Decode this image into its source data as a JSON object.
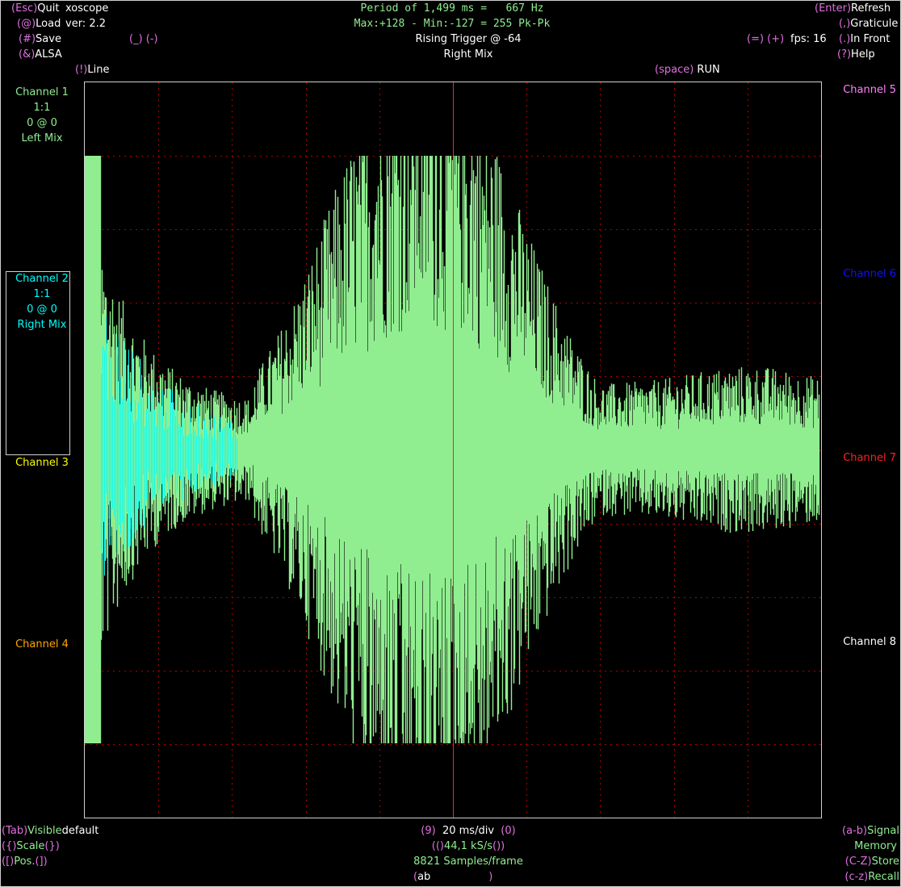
{
  "app": {
    "title": "xoscope",
    "version": "ver: 2.2"
  },
  "menu": {
    "quit": {
      "key": "(Esc)",
      "label": "Quit"
    },
    "load": {
      "key": "(@)",
      "label": "Load"
    },
    "save": {
      "key": "(#)",
      "label": "Save"
    },
    "alsa": {
      "key": "(&)",
      "label": "ALSA"
    },
    "line": {
      "key": "(!)",
      "label": "Line"
    },
    "refresh": {
      "key": "(Enter)",
      "label": "Refresh"
    },
    "graticule": {
      "key": "(,)",
      "label": "Graticule"
    },
    "in_front": {
      "key": "(.)",
      "label": "In Front"
    },
    "help": {
      "key": "(?)",
      "label": "Help"
    },
    "run": {
      "key": "(space)",
      "label": "RUN"
    },
    "minus_key": "(_) (-)",
    "plus_key": "(=) (+)",
    "fps": "fps: 16"
  },
  "measure": {
    "period": "Period of 1,499 ms =   667 Hz",
    "maxmin": "Max:+128 - Min:-127 = 255 Pk-Pk",
    "trigger": "Rising Trigger @ -64",
    "trigger_source": "Right Mix"
  },
  "channels": {
    "ch1": {
      "name": "Channel 1",
      "scale": "1:1",
      "pos": "0 @ 0",
      "source": "Left Mix",
      "color": "#90ee90"
    },
    "ch2": {
      "name": "Channel 2",
      "scale": "1:1",
      "pos": "0 @ 0",
      "source": "Right Mix",
      "color": "#00ffff"
    },
    "ch3": {
      "name": "Channel 3",
      "color": "#ffff00"
    },
    "ch4": {
      "name": "Channel 4",
      "color": "#ffa500"
    },
    "ch5": {
      "name": "Channel 5",
      "color": "#ff80ff"
    },
    "ch6": {
      "name": "Channel 6",
      "color": "#1010ff"
    },
    "ch7": {
      "name": "Channel 7",
      "color": "#ff2020"
    },
    "ch8": {
      "name": "Channel 8",
      "color": "#ffffff"
    }
  },
  "bottom": {
    "tab_key": "(Tab)",
    "visible_label": "Visible",
    "visible_value": "default",
    "scale_key_l": "({)",
    "scale_label": "Scale",
    "scale_key_r": "(})",
    "pos_key_l": "([)",
    "pos_label": "Pos.",
    "pos_key_r": "(])",
    "time_key_l": "(9)",
    "time_div": "20 ms/div",
    "time_key_r": "(0)",
    "rate_key_l": "(()",
    "rate": "44,1 kS/s",
    "rate_key_r": "())",
    "samples": "8821 Samples/frame",
    "math_key_l": "(",
    "math_value": "ab",
    "math_key_r": ")",
    "signal_key": "(a-b)",
    "signal_label": "Signal",
    "memory_label": "Memory",
    "store_key": "(C-Z)",
    "store_label": "Store",
    "recall_key": "(c-z)",
    "recall_label": "Recall"
  },
  "colors": {
    "graticule": "#b00000",
    "trigger_marker": "#ff2020",
    "trace_green": "#90ee90",
    "trace_cyan": "#00ffff",
    "key_magenta": "#e070e0"
  }
}
